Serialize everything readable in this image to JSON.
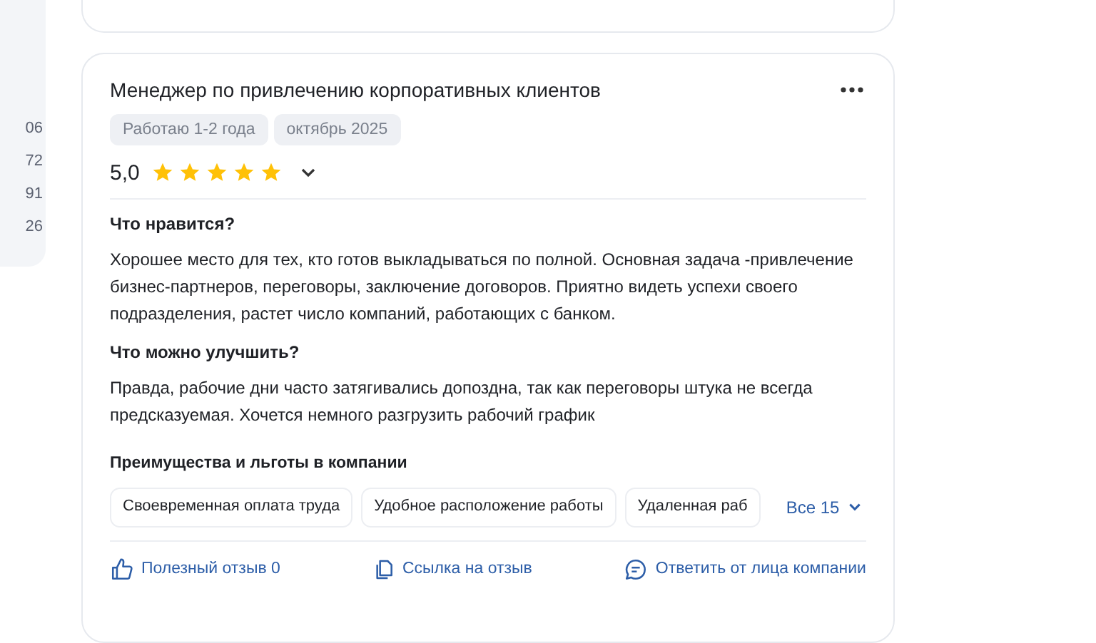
{
  "sidebar": {
    "numbers": [
      "06",
      "72",
      "91",
      "26"
    ]
  },
  "review": {
    "title": "Менеджер по привлечению корпоративных клиентов",
    "tags": [
      "Работаю 1-2 года",
      "октябрь 2025"
    ],
    "rating": "5,0",
    "stars": 5,
    "sections": [
      {
        "heading": "Что нравится?",
        "text": "Хорошее место для тех, кто готов выкладываться по полной. Основная задача -привлечение бизнес-партнеров, переговоры, заключение договоров. Приятно видеть успехи своего подразделения, растет число компаний, работающих с банком."
      },
      {
        "heading": "Что можно улучшить?",
        "text": "Правда, рабочие дни часто затягивались допоздна, так как переговоры штука не всегда предсказуемая. Хочется немного разгрузить рабочий график"
      }
    ],
    "benefits": {
      "heading": "Преимущества и льготы в компании",
      "items": [
        "Своевременная оплата труда",
        "Удобное расположение работы",
        "Удаленная раб"
      ],
      "more": "Все 15"
    },
    "actions": [
      {
        "kind": "like",
        "label": "Полезный отзыв 0"
      },
      {
        "kind": "link",
        "label": "Ссылка на отзыв"
      },
      {
        "kind": "reply",
        "label": "Ответить от лица компании"
      }
    ]
  }
}
